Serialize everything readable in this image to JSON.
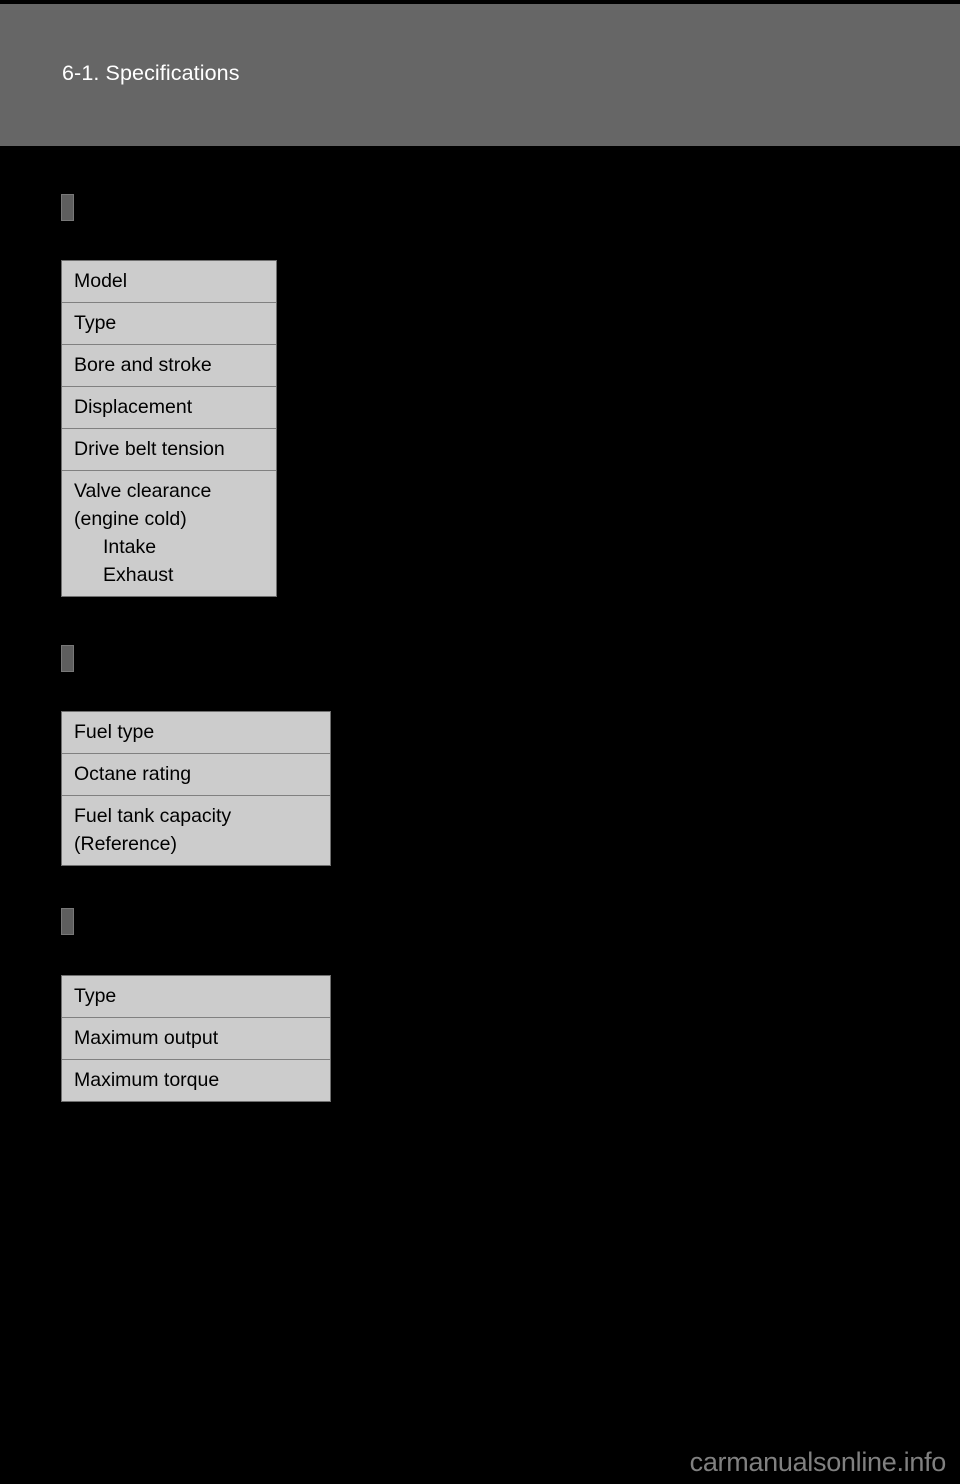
{
  "page": {
    "background_color": "#000000",
    "header": {
      "title": "6-1. Specifications",
      "background_color": "#666666",
      "text_color": "#ffffff"
    },
    "watermark": "carmanualsonline.info"
  },
  "sections": [
    {
      "id": "engine",
      "marker": "section-marker",
      "heading": "",
      "table": {
        "rows": [
          {
            "lines": [
              {
                "text": "Model",
                "indent": false
              }
            ]
          },
          {
            "lines": [
              {
                "text": "Type",
                "indent": false
              }
            ]
          },
          {
            "lines": [
              {
                "text": "Bore and stroke",
                "indent": false
              }
            ]
          },
          {
            "lines": [
              {
                "text": "Displacement",
                "indent": false
              }
            ]
          },
          {
            "lines": [
              {
                "text": "Drive belt tension",
                "indent": false
              }
            ]
          },
          {
            "lines": [
              {
                "text": "Valve clearance",
                "indent": false
              },
              {
                "text": "(engine cold)",
                "indent": false
              },
              {
                "text": "Intake",
                "indent": true
              },
              {
                "text": "Exhaust",
                "indent": true
              }
            ]
          }
        ]
      }
    },
    {
      "id": "fuel",
      "marker": "section-marker",
      "heading": "",
      "table": {
        "rows": [
          {
            "lines": [
              {
                "text": "Fuel type",
                "indent": false
              }
            ]
          },
          {
            "lines": [
              {
                "text": "Octane rating",
                "indent": false
              }
            ]
          },
          {
            "lines": [
              {
                "text": "Fuel tank capacity",
                "indent": false
              },
              {
                "text": "(Reference)",
                "indent": false
              }
            ]
          }
        ]
      }
    },
    {
      "id": "motor",
      "marker": "section-marker",
      "heading": "",
      "table": {
        "rows": [
          {
            "lines": [
              {
                "text": "Type",
                "indent": false
              }
            ]
          },
          {
            "lines": [
              {
                "text": "Maximum output",
                "indent": false
              }
            ]
          },
          {
            "lines": [
              {
                "text": "Maximum torque",
                "indent": false
              }
            ]
          }
        ]
      }
    }
  ],
  "colors": {
    "page_background": "#000000",
    "header_band": "#666666",
    "table_cell": "#cccccc",
    "table_border": "#6f6f6f",
    "row_separator": "#808080",
    "marker_fill": "#5e5e5e",
    "watermark_text": "#808080"
  }
}
